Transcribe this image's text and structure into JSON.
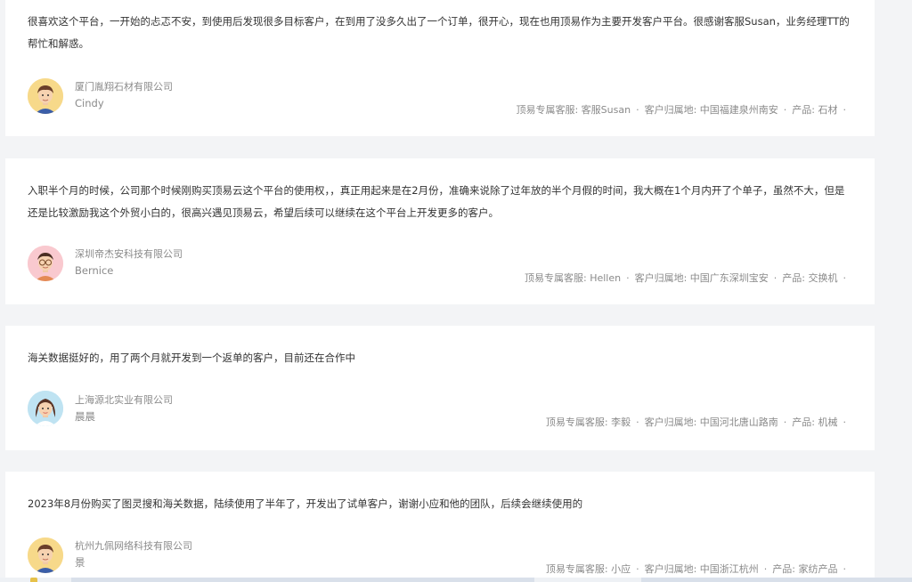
{
  "testimonials": [
    {
      "quote": "很喜欢这个平台，一开始的忐忑不安，到使用后发现很多目标客户，在到用了没多久出了一个订单，很开心，现在也用顶易作为主要开发客户平台。很感谢客服Susan，业务经理TT的帮忙和解惑。",
      "company": "厦门胤翔石材有限公司",
      "person": "Cindy",
      "service": "顶易专属客服: 客服Susan",
      "location": "客户归属地: 中国福建泉州南安",
      "product": "产品: 石材",
      "avatar": "man-avatar-icon",
      "avatar_bg": "#f7d98a"
    },
    {
      "quote": "入职半个月的时候，公司那个时候刚购买顶易云这个平台的使用权，，真正用起来是在2月份，准确来说除了过年放的半个月假的时间，我大概在1个月内开了个单子，虽然不大，但是还是比较激励我这个外贸小白的，很高兴遇见顶易云，希望后续可以继续在这个平台上开发更多的客户。",
      "company": "深圳帝杰安科技有限公司",
      "person": "Bernice",
      "service": "顶易专属客服: Hellen",
      "location": "客户归属地: 中国广东深圳宝安",
      "product": "产品: 交换机",
      "avatar": "glasses-man-avatar-icon",
      "avatar_bg": "#f9c9cf"
    },
    {
      "quote": "海关数据挺好的，用了两个月就开发到一个返单的客户，目前还在合作中",
      "company": "上海源北实业有限公司",
      "person": "晨晨",
      "service": "顶易专属客服: 李毅",
      "location": "客户归属地: 中国河北唐山路南",
      "product": "产品: 机械",
      "avatar": "woman-avatar-icon",
      "avatar_bg": "#bfe3f2"
    },
    {
      "quote": "2023年8月份购买了图灵搜和海关数据，陆续使用了半年了，开发出了试单客户，谢谢小应和他的团队，后续会继续使用的",
      "company": "杭州九佩网络科技有限公司",
      "person": "景",
      "service": "顶易专属客服: 小应",
      "location": "客户归属地: 中国浙江杭州",
      "product": "产品: 家纺产品",
      "avatar": "man-avatar-icon",
      "avatar_bg": "#f7d98a"
    }
  ],
  "separator": "·"
}
